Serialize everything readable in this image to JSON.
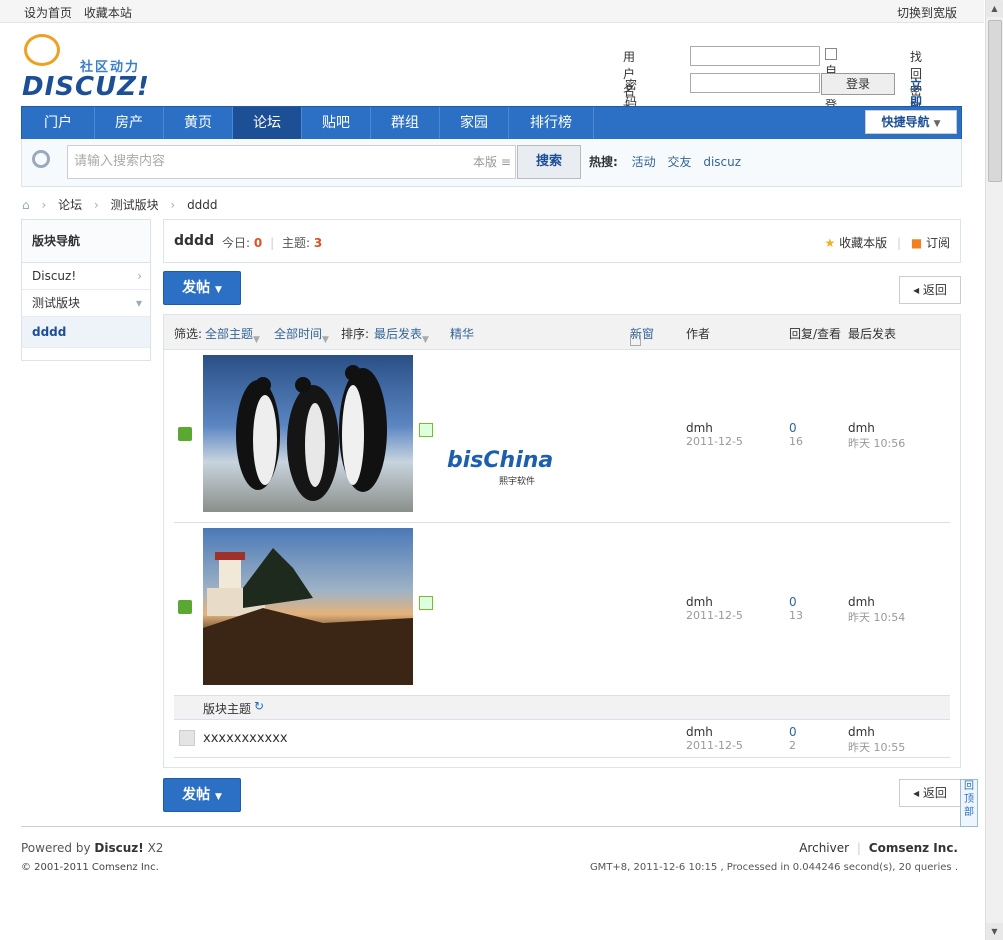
{
  "topbar": {
    "set_home": "设为首页",
    "bookmark": "收藏本站",
    "switch_width": "切换到宽版"
  },
  "logo": {
    "sub": "社区动力",
    "main": "DISCUZ!"
  },
  "login": {
    "username_label": "用户名",
    "password_label": "密码",
    "auto_login": "自动登录",
    "login_button": "登录",
    "forgot": "找回密码",
    "register": "立即注册"
  },
  "nav": {
    "items": [
      "门户",
      "房产",
      "黄页",
      "论坛",
      "贴吧",
      "群组",
      "家园",
      "排行榜"
    ],
    "current": "论坛",
    "quick": "快捷导航"
  },
  "search": {
    "placeholder": "请输入搜索内容",
    "scope": "本版",
    "button": "搜索",
    "hot_label": "热搜:",
    "hot": [
      "活动",
      "交友",
      "discuz"
    ]
  },
  "breadcrumb": [
    "论坛",
    "测试版块",
    "dddd"
  ],
  "sidebar": {
    "title": "版块导航",
    "items": [
      "Discuz!",
      "测试版块",
      "dddd"
    ]
  },
  "forum": {
    "name": "dddd",
    "today_label": "今日:",
    "today": "0",
    "topics_label": "主题:",
    "topics": "3",
    "favorite": "收藏本版",
    "subscribe": "订阅"
  },
  "buttons": {
    "post": "发帖",
    "back": "返回"
  },
  "filter": {
    "label": "筛选:",
    "all_topics": "全部主题",
    "all_time": "全部时间",
    "sort_label": "排序:",
    "sort": "最后发表",
    "digest": "精华",
    "newwin": "新窗",
    "author": "作者",
    "reply_view": "回复/查看",
    "last_post": "最后发表"
  },
  "threads": [
    {
      "author": "dmh",
      "date": "2011-12-5",
      "replies": "0",
      "views": "16",
      "last_user": "dmh",
      "last_time": "昨天 10:56",
      "brand": "bisChina",
      "brand_sub": "熙宇软件"
    },
    {
      "author": "dmh",
      "date": "2011-12-5",
      "replies": "0",
      "views": "13",
      "last_user": "dmh",
      "last_time": "昨天 10:54"
    }
  ],
  "section": {
    "label": "版块主题"
  },
  "normal_thread": {
    "title": "xxxxxxxxxxx",
    "author": "dmh",
    "date": "2011-12-5",
    "replies": "0",
    "views": "2",
    "last_user": "dmh",
    "last_time": "昨天 10:55"
  },
  "backtop": "回顶部",
  "footer": {
    "powered": "Powered by",
    "product": "Discuz!",
    "version": "X2",
    "copyright": "© 2001-2011 Comsenz Inc.",
    "archiver": "Archiver",
    "company": "Comsenz Inc.",
    "stats": "GMT+8, 2011-12-6 10:15 , Processed in 0.044246 second(s), 20 queries ."
  },
  "colors": {
    "nav": "#2b70c4",
    "accent": "#1d4f96",
    "count": "#e05020"
  }
}
